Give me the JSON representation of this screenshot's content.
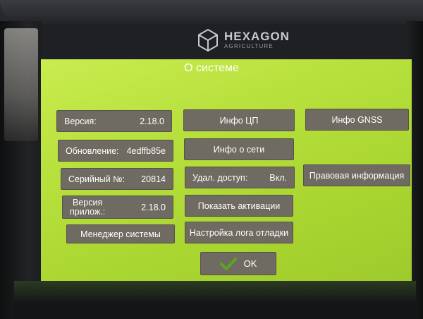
{
  "brand": {
    "name": "HEXAGON",
    "subtitle": "AGRICULTURE"
  },
  "dialog": {
    "title": "О системе"
  },
  "info": {
    "version_label": "Версия:",
    "version_value": "2.18.0",
    "update_label": "Обновление:",
    "update_value": "4edffb85e",
    "serial_label": "Серийный №:",
    "serial_value": "20814",
    "app_version_label_1": "Версия",
    "app_version_label_2": "прилож.:",
    "app_version_value": "2.18.0"
  },
  "buttons": {
    "cpu_info": "Инфо ЦП",
    "network_info": "Инфо о сети",
    "remote_access_label": "Удал. доступ:",
    "remote_access_value": "Вкл.",
    "show_activations": "Показать активации",
    "debug_log": "Настройка лога отладки",
    "system_manager": "Менеджер системы",
    "gnss_info": "Инфо GNSS",
    "legal_info": "Правовая информация",
    "ok": "OK"
  },
  "colors": {
    "screen_green": "#b7e03c",
    "button_gray": "#6f6b62",
    "check_green": "#5aa420"
  },
  "icons": {
    "ok": "check-icon",
    "logo": "hexagon-logo-icon"
  }
}
